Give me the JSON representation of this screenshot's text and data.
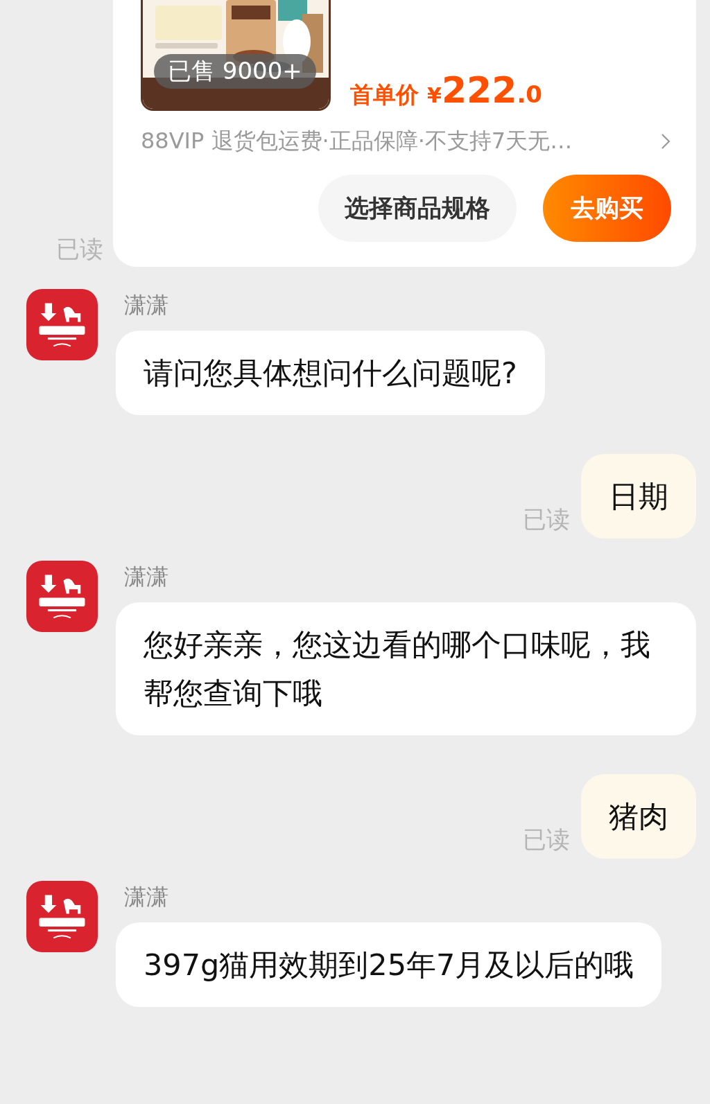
{
  "product_card": {
    "image": {
      "kind": "picture",
      "sold_badge": "已售 9000+"
    },
    "price": {
      "label": "首单价",
      "currency": "¥",
      "integer": "222",
      "decimal": ".0"
    },
    "services": "88VIP 退货包运费·正品保障·不支持7天无…",
    "buttons": [
      {
        "kind": "secondary",
        "label": "选择商品规格"
      },
      {
        "kind": "primary",
        "label": "去购买"
      }
    ],
    "read_status": "已读"
  },
  "messages": [
    {
      "kind": "agent",
      "sender": "潇潇",
      "text": "请问您具体想问什么问题呢?"
    },
    {
      "kind": "user",
      "text": "日期",
      "read_status": "已读"
    },
    {
      "kind": "agent",
      "sender": "潇潇",
      "text": "您好亲亲，您这边看的哪个口味呢，我帮您查询下哦"
    },
    {
      "kind": "user",
      "text": "猪肉",
      "read_status": "已读"
    },
    {
      "kind": "agent",
      "sender": "潇潇",
      "text": "397g猫用效期到25年7月及以后的哦"
    }
  ]
}
